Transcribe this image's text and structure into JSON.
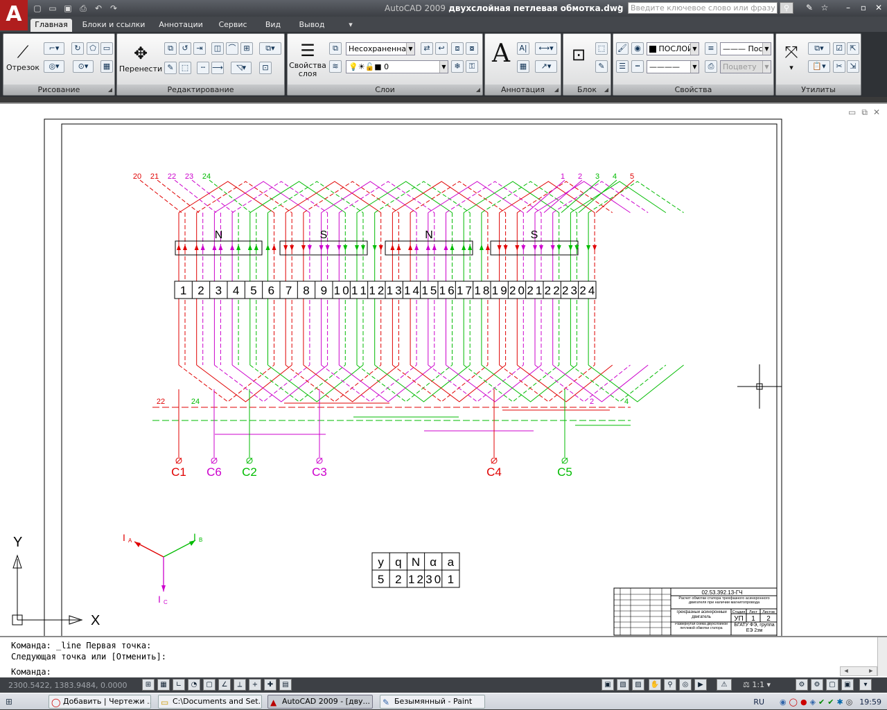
{
  "title": {
    "app": "AutoCAD 2009",
    "file": "двухслойная петлевая обмотка.dwg"
  },
  "search": {
    "placeholder": "Введите ключевое слово или фразу"
  },
  "ribbon_tabs": [
    "Главная",
    "Блоки и ссылки",
    "Аннотации",
    "Сервис",
    "Вид",
    "Вывод"
  ],
  "panels": {
    "draw": {
      "title": "Рисование",
      "line": "Отрезок"
    },
    "modify": {
      "title": "Редактирование",
      "move": "Перенести"
    },
    "layers": {
      "title": "Слои",
      "properties": "Свойства\nслоя",
      "state": "Несохраненная",
      "current_layer": "0"
    },
    "annotation": {
      "title": "Аннотация"
    },
    "block": {
      "title": "Блок"
    },
    "properties": {
      "title": "Свойства",
      "color": "ПОСЛОЙ",
      "linetype": "Пос",
      "lineweight": "Поцвету"
    },
    "utilities": {
      "title": "Утилиты"
    }
  },
  "drawing": {
    "top_labels_left": [
      "20",
      "21",
      "22",
      "23",
      "24"
    ],
    "top_labels_right": [
      "1",
      "2",
      "3",
      "4",
      "5"
    ],
    "poles": [
      "N",
      "S",
      "N",
      "S"
    ],
    "slots": [
      "1",
      "2",
      "3",
      "4",
      "5",
      "6",
      "7",
      "8",
      "9",
      "10",
      "11",
      "12",
      "13",
      "14",
      "15",
      "16",
      "17",
      "18",
      "19",
      "20",
      "21",
      "22",
      "23",
      "24"
    ],
    "left_end_labels": [
      "22",
      "24"
    ],
    "right_end_labels": [
      "2",
      "4"
    ],
    "terminals": [
      {
        "name": "C1",
        "color": "#e00000"
      },
      {
        "name": "C6",
        "color": "#cc00cc"
      },
      {
        "name": "C2",
        "color": "#00bb00"
      },
      {
        "name": "C3",
        "color": "#cc00cc"
      },
      {
        "name": "C4",
        "color": "#e00000"
      },
      {
        "name": "C5",
        "color": "#00bb00"
      }
    ],
    "phasors": {
      "a": "I",
      "a_sub": "A",
      "b": "I",
      "b_sub": "B",
      "c": "I",
      "c_sub": "C"
    },
    "ucs": {
      "y": "Y",
      "x": "X"
    },
    "param_table": {
      "headers": [
        "y",
        "q",
        "N",
        "α",
        "a"
      ],
      "values": [
        "5",
        "2",
        "12",
        "30",
        "1"
      ]
    },
    "title_block": {
      "code": "02.53.392.13-ГЧ",
      "desc": "Расчет обмотки статора трехфазного асинхронного двигателя при наличии магнитопровода",
      "subject": "Трехфазный асинхронный двигатель",
      "sheet_name": "Развернутая схема двухслойной петлевой обмотки статора",
      "stage_hdr": "Стадия",
      "sheet_hdr": "Лист",
      "sheets_hdr": "Листов",
      "stage": "УП",
      "sheet": "1",
      "sheets": "2",
      "org": "БГАТУ ФЭ, группа ЕЭ 2зм"
    },
    "colors": {
      "phase_a": "#e00000",
      "phase_b": "#00bb00",
      "phase_c": "#cc00cc"
    }
  },
  "command": {
    "line1": "Команда: _line Первая точка:",
    "line2": "Следующая точка или [Отменить]:",
    "prompt": "Команда:"
  },
  "status": {
    "coords": "2300.5422, 1383.9484, 0.0000",
    "scale": "1:1"
  },
  "taskbar": {
    "items": [
      "Добавить | Чертежи ...",
      "C:\\Documents and Set...",
      "AutoCAD 2009 - [дву...",
      "Безымянный - Paint"
    ],
    "lang": "RU",
    "time": "19:59"
  }
}
